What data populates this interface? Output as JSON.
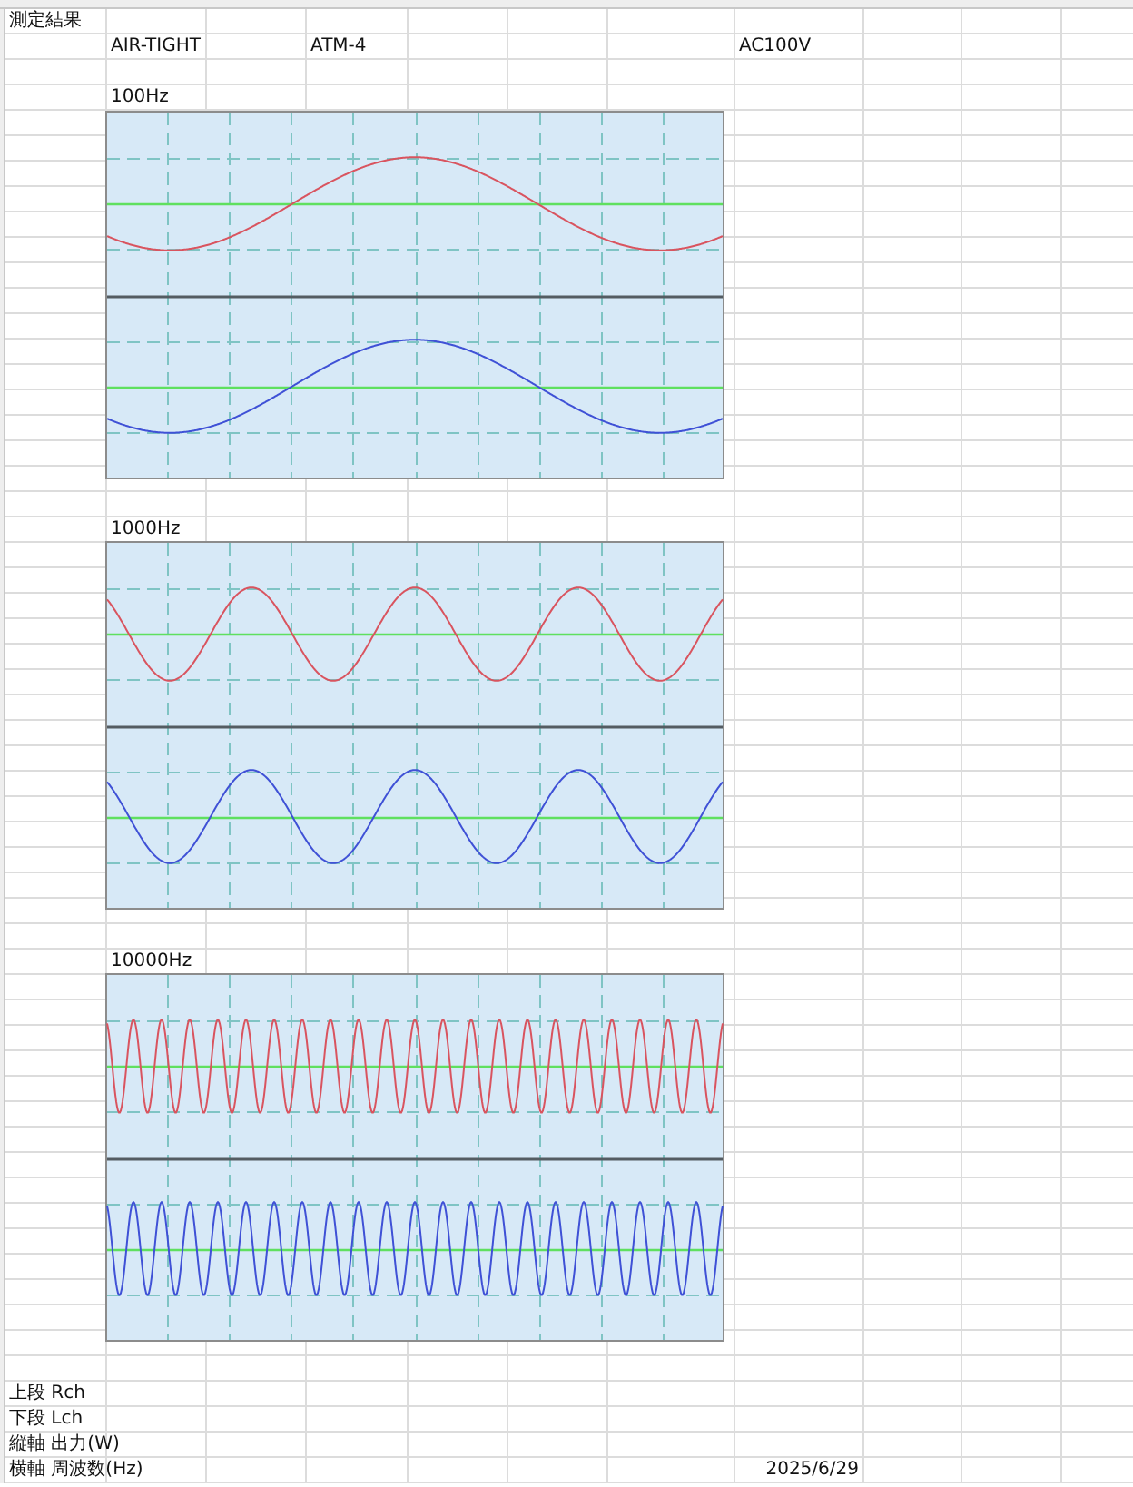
{
  "sheet": {
    "title": "測定結果",
    "header_row": [
      "AIR-TIGHT",
      "ATM-4",
      "AC100V"
    ],
    "charts": [
      {
        "label": "100Hz",
        "traces": [
          {
            "color": "#d9545f"
          },
          {
            "color": "#3f51d6"
          }
        ]
      },
      {
        "label": "1000Hz",
        "traces": [
          {
            "color": "#d9545f"
          },
          {
            "color": "#3f51d6"
          }
        ]
      },
      {
        "label": "10000Hz",
        "traces": [
          {
            "color": "#d9545f"
          },
          {
            "color": "#3f51d6"
          }
        ]
      }
    ],
    "legend": [
      "上段 Rch",
      "下段 Lch",
      "縦軸 出力(W)",
      "横軸 周波数(Hz)"
    ],
    "date": "2025/6/29"
  }
}
